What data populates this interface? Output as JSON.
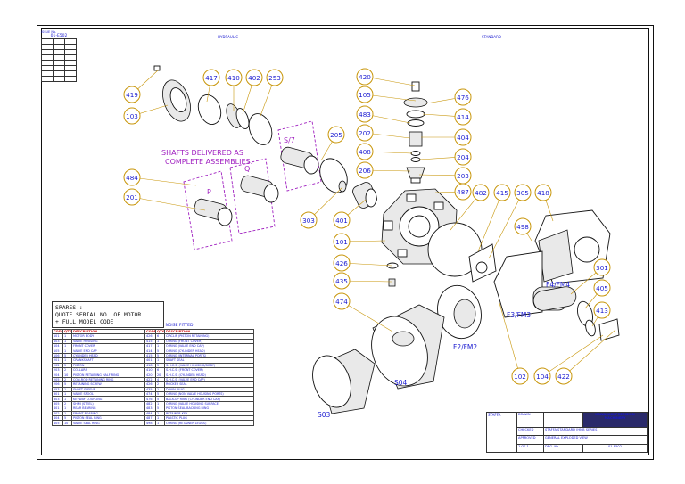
{
  "header": {
    "top_left_label": "ISSUE No.",
    "top_left_code": "01-E502",
    "zone_top_1": "HYDRAULIC",
    "zone_top_2": "STANDARD"
  },
  "callouts": [
    "419",
    "103",
    "417",
    "410",
    "402",
    "253",
    "420",
    "105",
    "476",
    "414",
    "483",
    "404",
    "202",
    "408",
    "204",
    "206",
    "203",
    "205",
    "484",
    "201",
    "303",
    "401",
    "487",
    "482",
    "415",
    "305",
    "418",
    "498",
    "101",
    "426",
    "435",
    "301",
    "405",
    "474",
    "413",
    "102",
    "104",
    "422"
  ],
  "assemblies": {
    "note_line1": "SHAFTS DELIVERED AS",
    "note_line2": "COMPLETE ASSEMBLIES.",
    "p": "P",
    "q": "Q",
    "s7": "S/7"
  },
  "housings": {
    "f4": "F4/FM4",
    "f3": "F3/FM3",
    "f2": "F2/FM2",
    "s04": "S04",
    "s03": "S03"
  },
  "spares": {
    "line1": "SPARES :",
    "line2": "QUOTE SERIAL NO. OF MOTOR",
    "line3": "+ FULL MODEL CODE"
  },
  "bom": {
    "title": "NOISE FITTED",
    "headers": [
      "CODE",
      "QTY.",
      "DESCRIPTION",
      "CODE",
      "QTY.",
      "DESCRIPTION"
    ],
    "rows": [
      [
        "101",
        "1",
        "MOTOR BODY",
        "426",
        "6",
        "CIRCLIP (PISTON RETAINING)"
      ],
      [
        "103",
        "1",
        "VALVE HOUSING",
        "415",
        "1",
        "O-RING (FRONT COVER)"
      ],
      [
        "104",
        "1",
        "FRONT COVER",
        "417",
        "1",
        "O-RING (VALVE END CAP)"
      ],
      [
        "105",
        "1",
        "VALVE END CAP",
        "414",
        "5",
        "O-RING (CYLINDER HEAD)"
      ],
      [
        "106",
        "5",
        "CYLINDER HEAD",
        "415",
        "5",
        "O-RING (INTERNAL PORTS)"
      ],
      [
        "201",
        "1",
        "CRANKSHAFT",
        "401",
        "1",
        "SHAFT SEAL"
      ],
      [
        "202",
        "5",
        "PISTON",
        "418",
        "5",
        "S.H.C.S. (VALVE HOUSING/BODY)"
      ],
      [
        "203",
        "2",
        "COLLARS",
        "410",
        "6",
        "S.H.C.S. (FRONT COVER)"
      ],
      [
        "204",
        "10",
        "PISTON RETAINING HALF RING",
        "420",
        "20",
        "S.H.C.S. (CYLINDER HEAD)"
      ],
      [
        "205",
        "2",
        "CON-ROD RETAINING RING",
        "422",
        "4",
        "S.H.C.S. (VALVE END CAP)"
      ],
      [
        "206",
        "5",
        "RETAINING SCREW",
        "426",
        "2",
        "ROCKER SEAL"
      ],
      [
        "253",
        "1",
        "SHAFT SLEEVE",
        "435",
        "1",
        "DRAIN PLUG"
      ],
      [
        "301",
        "1",
        "VALVE SPOOL",
        "474",
        "5",
        "O-RING (NON VALVE HOUSING PORTS)"
      ],
      [
        "303",
        "1",
        "KEYWAY COUPLING",
        "476",
        "5",
        "BACK-UP RING (CYLINDER END CAP)"
      ],
      [
        "305",
        "2",
        "SHIM (STEEL)",
        "482",
        "1",
        "O-RING (VALVE HOUSING SURFACE)"
      ],
      [
        "401",
        "1",
        "REAR BEARING",
        "483",
        "5",
        "PISTON SEAL BACKING RING"
      ],
      [
        "402",
        "1",
        "FRONT BEARING",
        "484",
        "1",
        "RETAINER KEY"
      ],
      [
        "404",
        "5",
        "PISTON SEAL RING",
        "487",
        "1",
        "PLASTIC PLUG"
      ],
      [
        "405",
        "10",
        "VALVE SEAL RING",
        "498",
        "1",
        "O-RING (RETAINER LEGGS)"
      ]
    ]
  },
  "title_block": {
    "company": "STAFFA",
    "company_sub": "KAWASAKI PRECISION MACHINERY",
    "desc_line1": "STAFFA STANDARD (HMB SERIES)",
    "desc_line2": "GENERAL EXPLODED VIEW",
    "drawing_no": "01-E502",
    "sheet": "1 OF 1",
    "label_drawn": "DRAWN",
    "label_checked": "CHECKED",
    "label_approved": "APPROVED",
    "label_dwg": "DRG. No."
  }
}
